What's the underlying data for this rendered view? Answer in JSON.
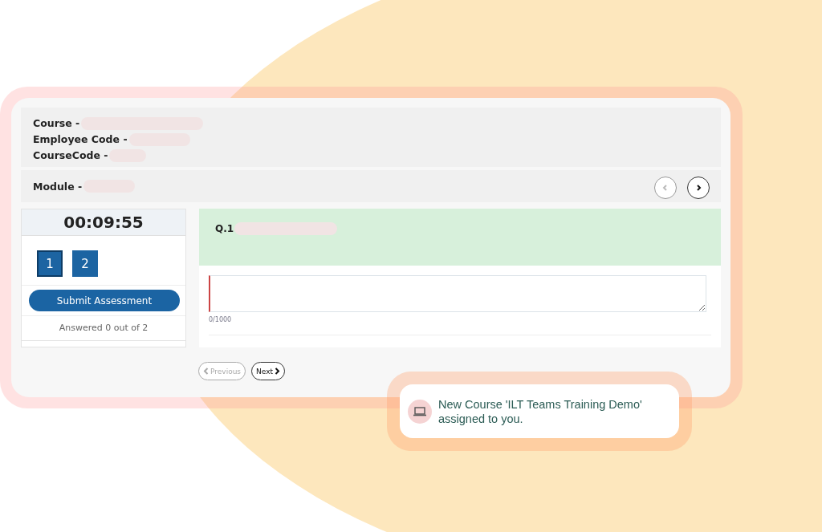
{
  "header": {
    "fields": [
      {
        "label": "Course -",
        "redacted": true
      },
      {
        "label": "Employee Code -",
        "redacted": true
      },
      {
        "label": "CourseCode -",
        "redacted": true
      }
    ]
  },
  "module": {
    "label": "Module -",
    "redacted": true,
    "nav": [
      {
        "kind": "prev",
        "disabled": true
      },
      {
        "kind": "next",
        "disabled": false
      }
    ]
  },
  "timer": "00:09:55",
  "questions": [
    {
      "label": "1",
      "selected": true
    },
    {
      "label": "2",
      "selected": false
    }
  ],
  "submit_button": "Submit Assessment",
  "progress_text": "Answered 0 out of 2",
  "question": {
    "label": "Q.1",
    "redacted": true,
    "char_count": "0/1000"
  },
  "pager": [
    {
      "label": "Previous",
      "kind": "prev",
      "disabled": true
    },
    {
      "label": "Next",
      "kind": "next",
      "disabled": false
    }
  ],
  "toast": {
    "message": "New Course 'ILT Teams Training Demo' assigned to you."
  }
}
